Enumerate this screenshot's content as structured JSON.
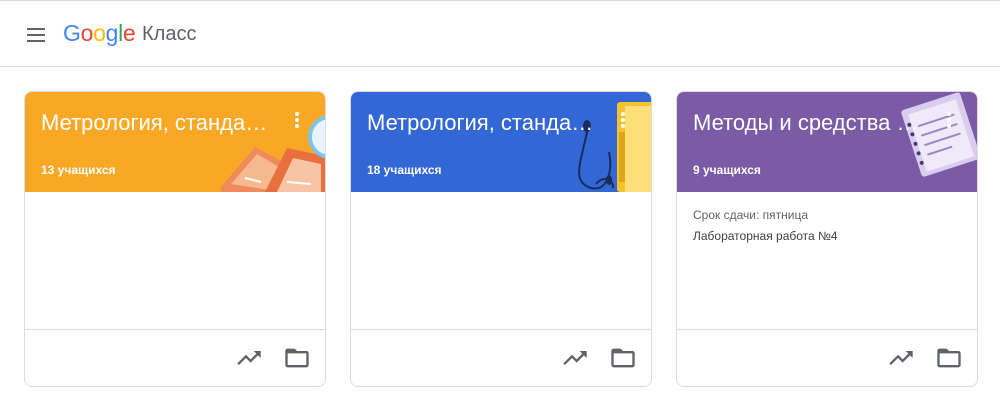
{
  "header": {
    "logo_letters": [
      "G",
      "o",
      "o",
      "g",
      "l",
      "e"
    ],
    "product_name": "Класс",
    "menu_icon": "hamburger-menu-icon"
  },
  "cards": [
    {
      "title": "Метрология, стандартизация и сертификация",
      "students": "13 учащихся",
      "color": "#f9a825",
      "illustration": "books-and-protractor",
      "due_label": "",
      "due_item": "",
      "footer_icons": [
        "trending-up-icon",
        "folder-icon"
      ]
    },
    {
      "title": "Метрология, стандартизация и сертификация",
      "students": "18 учащихся",
      "color": "#3367d6",
      "illustration": "headphones-and-book",
      "due_label": "",
      "due_item": "",
      "footer_icons": [
        "trending-up-icon",
        "folder-icon"
      ]
    },
    {
      "title": "Методы и средства измерений",
      "students": "9 учащихся",
      "color": "#7b5aa6",
      "illustration": "notepad",
      "due_label": "Срок сдачи: пятница",
      "due_item": "Лабораторная работа №4",
      "footer_icons": [
        "trending-up-icon",
        "folder-icon"
      ]
    }
  ]
}
